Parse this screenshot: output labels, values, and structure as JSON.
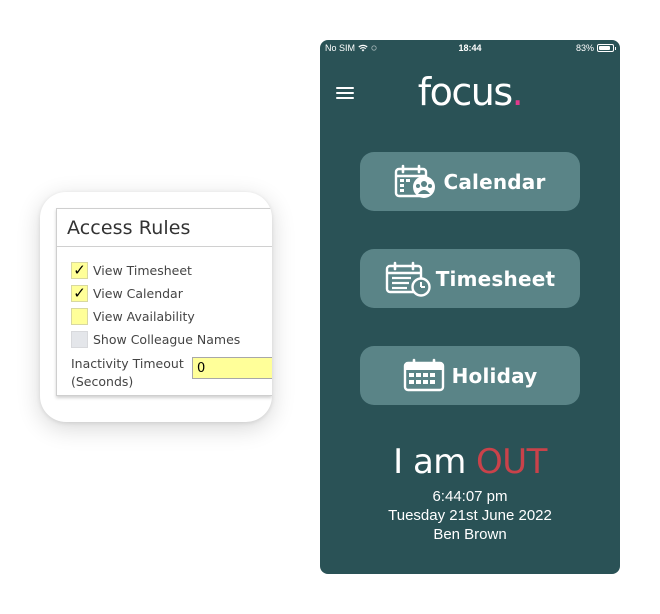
{
  "access_rules": {
    "title": "Access Rules",
    "items": [
      {
        "label": "View Timesheet",
        "checked": true,
        "checkmark": "✓"
      },
      {
        "label": "View Calendar",
        "checked": true,
        "checkmark": "✓"
      },
      {
        "label": "View Availability",
        "checked": false,
        "checkmark": ""
      },
      {
        "label": "Show Colleague Names",
        "checked": false,
        "checkmark": ""
      }
    ],
    "timeout_label_line1": "Inactivity Timeout",
    "timeout_label_line2": "(Seconds)",
    "timeout_value": "0",
    "field_color": "#ffff99"
  },
  "phone": {
    "status_bar": {
      "carrier": "No SIM",
      "time": "18:44",
      "battery": "83%",
      "battery_level": 0.83
    },
    "logo": {
      "text": "focus",
      "dot": ".",
      "dot_color": "#e23a8c"
    },
    "menu": [
      {
        "label": "Calendar",
        "icon": "calendar-people-icon"
      },
      {
        "label": "Timesheet",
        "icon": "timesheet-clock-icon"
      },
      {
        "label": "Holiday",
        "icon": "holiday-calendar-icon"
      }
    ],
    "status": {
      "prefix": "I am",
      "state": "OUT",
      "state_color": "#c9424a"
    },
    "clock_time": "6:44:07 pm",
    "date": "Tuesday 21st June 2022",
    "user_name": "Ben Brown",
    "background_color": "#2a5256",
    "button_color": "#5a8487"
  }
}
